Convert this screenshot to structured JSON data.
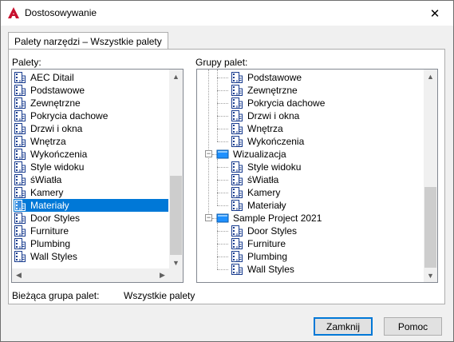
{
  "window": {
    "title": "Dostosowywanie",
    "close_glyph": "✕"
  },
  "tab": {
    "label": "Palety narzędzi – Wszystkie palety"
  },
  "palettes": {
    "label": "Palety:",
    "items": [
      {
        "label": "AEC Ditail",
        "icon": "palette-icon"
      },
      {
        "label": "Podstawowe",
        "icon": "palette-icon"
      },
      {
        "label": "Zewnętrzne",
        "icon": "palette-icon"
      },
      {
        "label": "Pokrycia dachowe",
        "icon": "palette-icon"
      },
      {
        "label": "Drzwi i okna",
        "icon": "palette-icon"
      },
      {
        "label": "Wnętrza",
        "icon": "palette-icon"
      },
      {
        "label": "Wykończenia",
        "icon": "palette-icon"
      },
      {
        "label": "Style widoku",
        "icon": "palette-icon"
      },
      {
        "label": "śWiatła",
        "icon": "palette-icon"
      },
      {
        "label": "Kamery",
        "icon": "palette-icon"
      },
      {
        "label": "Materiały",
        "icon": "palette-icon",
        "selected": true
      },
      {
        "label": "Door Styles",
        "icon": "palette-icon"
      },
      {
        "label": "Furniture",
        "icon": "palette-icon"
      },
      {
        "label": "Plumbing",
        "icon": "palette-icon"
      },
      {
        "label": "Wall Styles",
        "icon": "palette-icon"
      }
    ]
  },
  "groups": {
    "label": "Grupy palet:",
    "items": [
      {
        "label": "Podstawowe",
        "type": "palette"
      },
      {
        "label": "Zewnętrzne",
        "type": "palette"
      },
      {
        "label": "Pokrycia dachowe",
        "type": "palette"
      },
      {
        "label": "Drzwi i okna",
        "type": "palette"
      },
      {
        "label": "Wnętrza",
        "type": "palette"
      },
      {
        "label": "Wykończenia",
        "type": "palette"
      },
      {
        "label": "Wizualizacja",
        "type": "group",
        "expander": "−"
      },
      {
        "label": "Style widoku",
        "type": "palette"
      },
      {
        "label": "śWiatła",
        "type": "palette"
      },
      {
        "label": "Kamery",
        "type": "palette"
      },
      {
        "label": "Materiały",
        "type": "palette"
      },
      {
        "label": "Sample Project 2021",
        "type": "group",
        "expander": "−"
      },
      {
        "label": "Door Styles",
        "type": "palette"
      },
      {
        "label": "Furniture",
        "type": "palette"
      },
      {
        "label": "Plumbing",
        "type": "palette"
      },
      {
        "label": "Wall Styles",
        "type": "palette"
      }
    ]
  },
  "current_group": {
    "label": "Bieżąca grupa palet:",
    "value": "Wszystkie palety"
  },
  "buttons": {
    "close": "Zamknij",
    "help": "Pomoc"
  },
  "colors": {
    "selection": "#0078d7",
    "app_icon": "#c8102e",
    "folder": "#1e90ff"
  }
}
